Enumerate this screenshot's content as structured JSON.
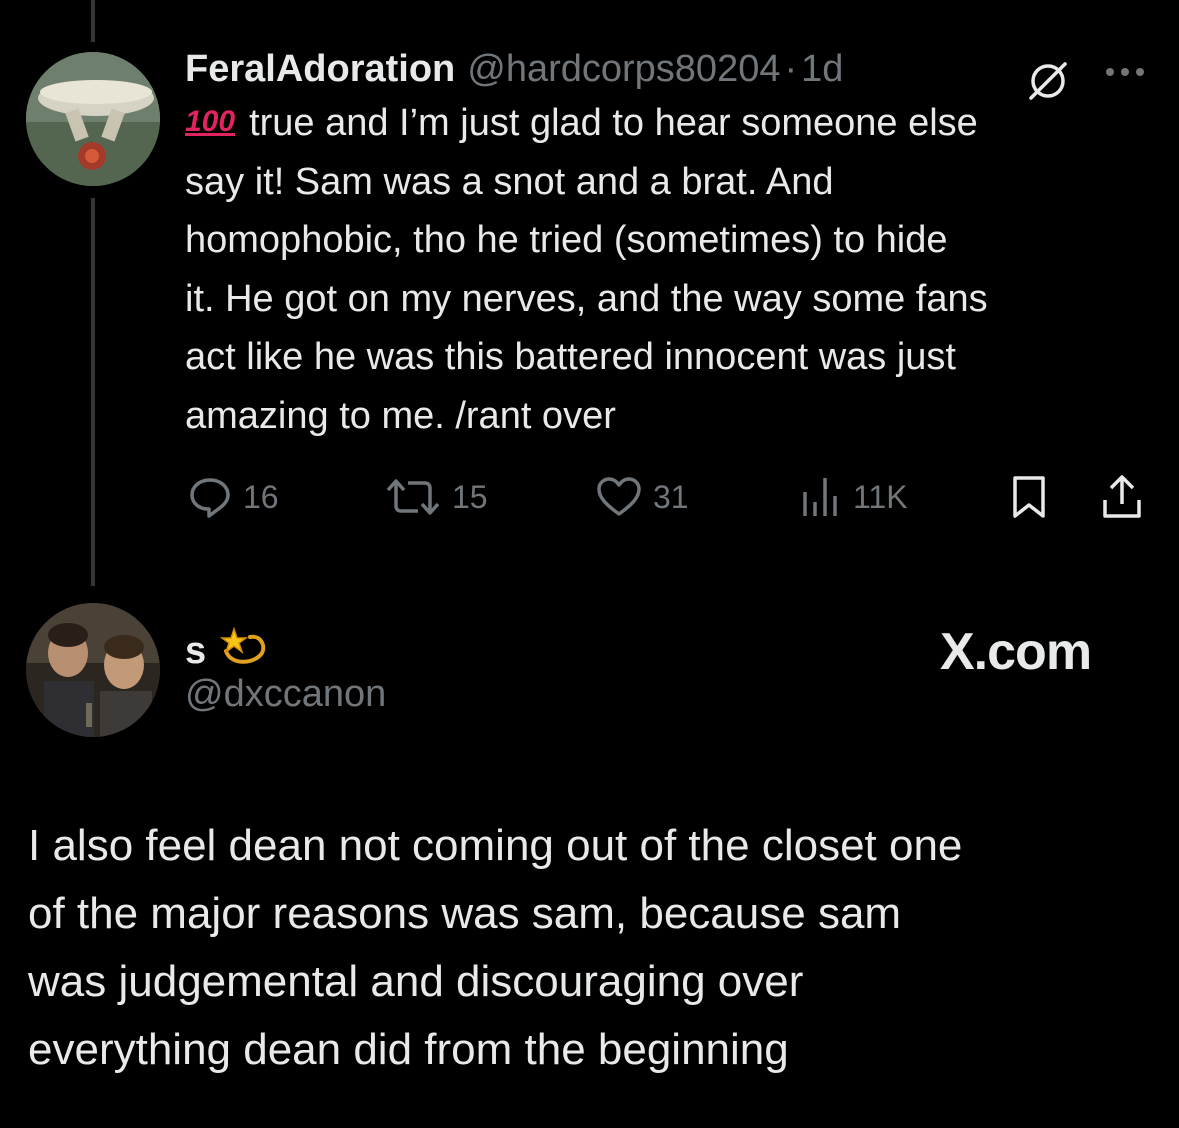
{
  "reply": {
    "display_name": "FeralAdoration",
    "handle": "@hardcorps80204",
    "separator": "·",
    "time": "1d",
    "emoji_text": "100",
    "lines": [
      "true and I’m just glad to hear someone else",
      "say it! Sam was a snot and a brat. And",
      "homophobic, tho he tried (sometimes) to hide",
      "it. He got on my nerves, and the way some fans",
      "act like he was this battered innocent was just",
      "amazing to me. /rant over"
    ],
    "actions": {
      "replies": "16",
      "retweets": "15",
      "likes": "31",
      "views": "11K"
    }
  },
  "quoted": {
    "display_name": "s",
    "handle": "@dxccanon",
    "source": "X.com",
    "lines": [
      "I also feel dean not coming out of the closet one",
      "of the major reasons was sam, because sam",
      "was judgemental and discouraging over",
      "everything dean did from the beginning"
    ]
  },
  "icons": [
    "reply-icon",
    "retweet-icon",
    "like-icon",
    "views-icon",
    "bookmark-icon",
    "share-icon",
    "grok-icon",
    "more-icon",
    "dizzy-icon"
  ],
  "colors": {
    "background": "#000000",
    "text": "#e7e9ea",
    "secondary": "#71767b"
  }
}
